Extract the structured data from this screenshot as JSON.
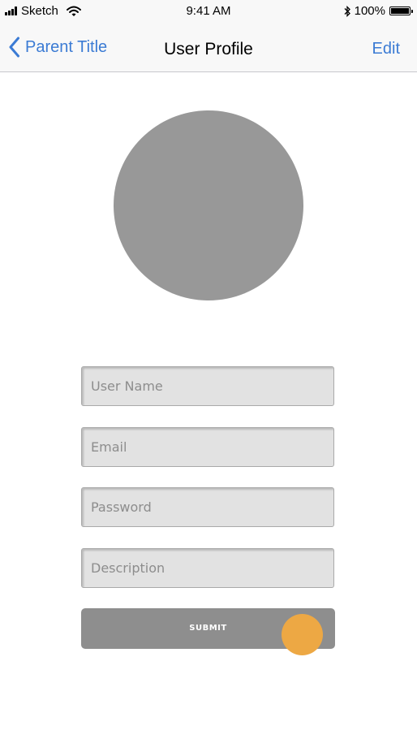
{
  "status_bar": {
    "carrier": "Sketch",
    "time": "9:41 AM",
    "battery": "100%",
    "battery_level": 1.0,
    "icons": [
      "signal-icon",
      "wifi-icon",
      "bluetooth-icon",
      "battery-icon"
    ]
  },
  "nav": {
    "back_label": "Parent Title",
    "back_icon": "chevron-left-icon",
    "title": "User Profile",
    "edit_label": "Edit"
  },
  "form": {
    "username_placeholder": "User Name",
    "email_placeholder": "Email",
    "password_placeholder": "Password",
    "description_placeholder": "Description",
    "submit_label": "SUBMIT"
  },
  "colors": {
    "accent": "#3b7bd4",
    "avatar": "#989898",
    "field_bg": "#e2e2e2",
    "button_bg": "#8e8e8e",
    "touch_indicator": "#eda844"
  }
}
